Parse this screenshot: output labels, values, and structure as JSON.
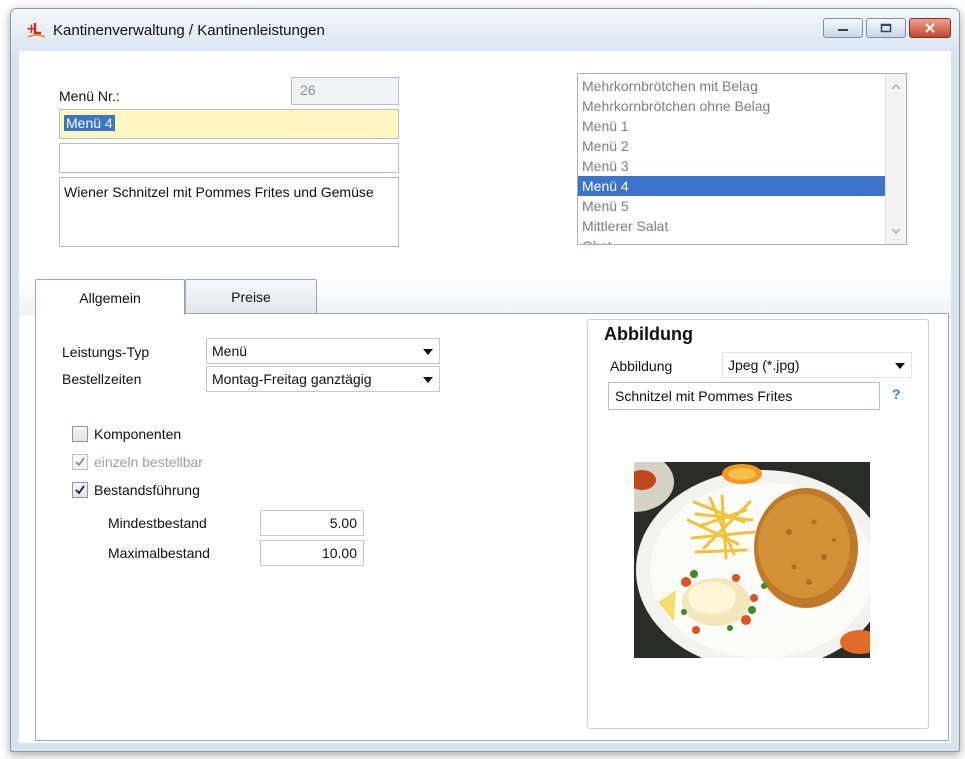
{
  "window": {
    "title": "Kantinenverwaltung / Kantinenleistungen"
  },
  "header": {
    "menu_nr_label": "Menü Nr.:",
    "menu_nr_value": "26",
    "name_value": "Menü 4",
    "second_value": "",
    "description": "Wiener Schnitzel mit Pommes Frites und Gemüse"
  },
  "list": {
    "items": [
      {
        "label": "Mehrkornbrötchen mit Belag"
      },
      {
        "label": "Mehrkornbrötchen ohne Belag"
      },
      {
        "label": "Menü 1"
      },
      {
        "label": "Menü 2"
      },
      {
        "label": "Menü 3"
      },
      {
        "label": "Menü 4"
      },
      {
        "label": "Menü 5"
      },
      {
        "label": "Mittlerer Salat"
      },
      {
        "label": "Obst"
      }
    ],
    "selected": "Menü 4"
  },
  "tabs": [
    {
      "label": "Allgemein",
      "active": true
    },
    {
      "label": "Preise",
      "active": false
    }
  ],
  "allgemein": {
    "leistungstyp_label": "Leistungs-Typ",
    "leistungstyp_value": "Menü",
    "bestellzeiten_label": "Bestellzeiten",
    "bestellzeiten_value": "Montag-Freitag  ganztägig",
    "komponenten_label": "Komponenten",
    "komponenten_checked": false,
    "einzeln_label": "einzeln bestellbar",
    "einzeln_checked": true,
    "bestand_label": "Bestandsführung",
    "bestand_checked": true,
    "mindest_label": "Mindestbestand",
    "mindest_value": "5.00",
    "maximal_label": "Maximalbestand",
    "maximal_value": "10.00"
  },
  "abbildung": {
    "heading": "Abbildung",
    "type_label": "Abbildung",
    "type_value": "Jpeg  (*.jpg)",
    "caption_value": "Schnitzel mit Pommes Frites",
    "help_symbol": "?"
  },
  "colors": {
    "selection": "#3b74c9",
    "highlight_field": "#fff6c2",
    "help": "#2f83c4"
  }
}
